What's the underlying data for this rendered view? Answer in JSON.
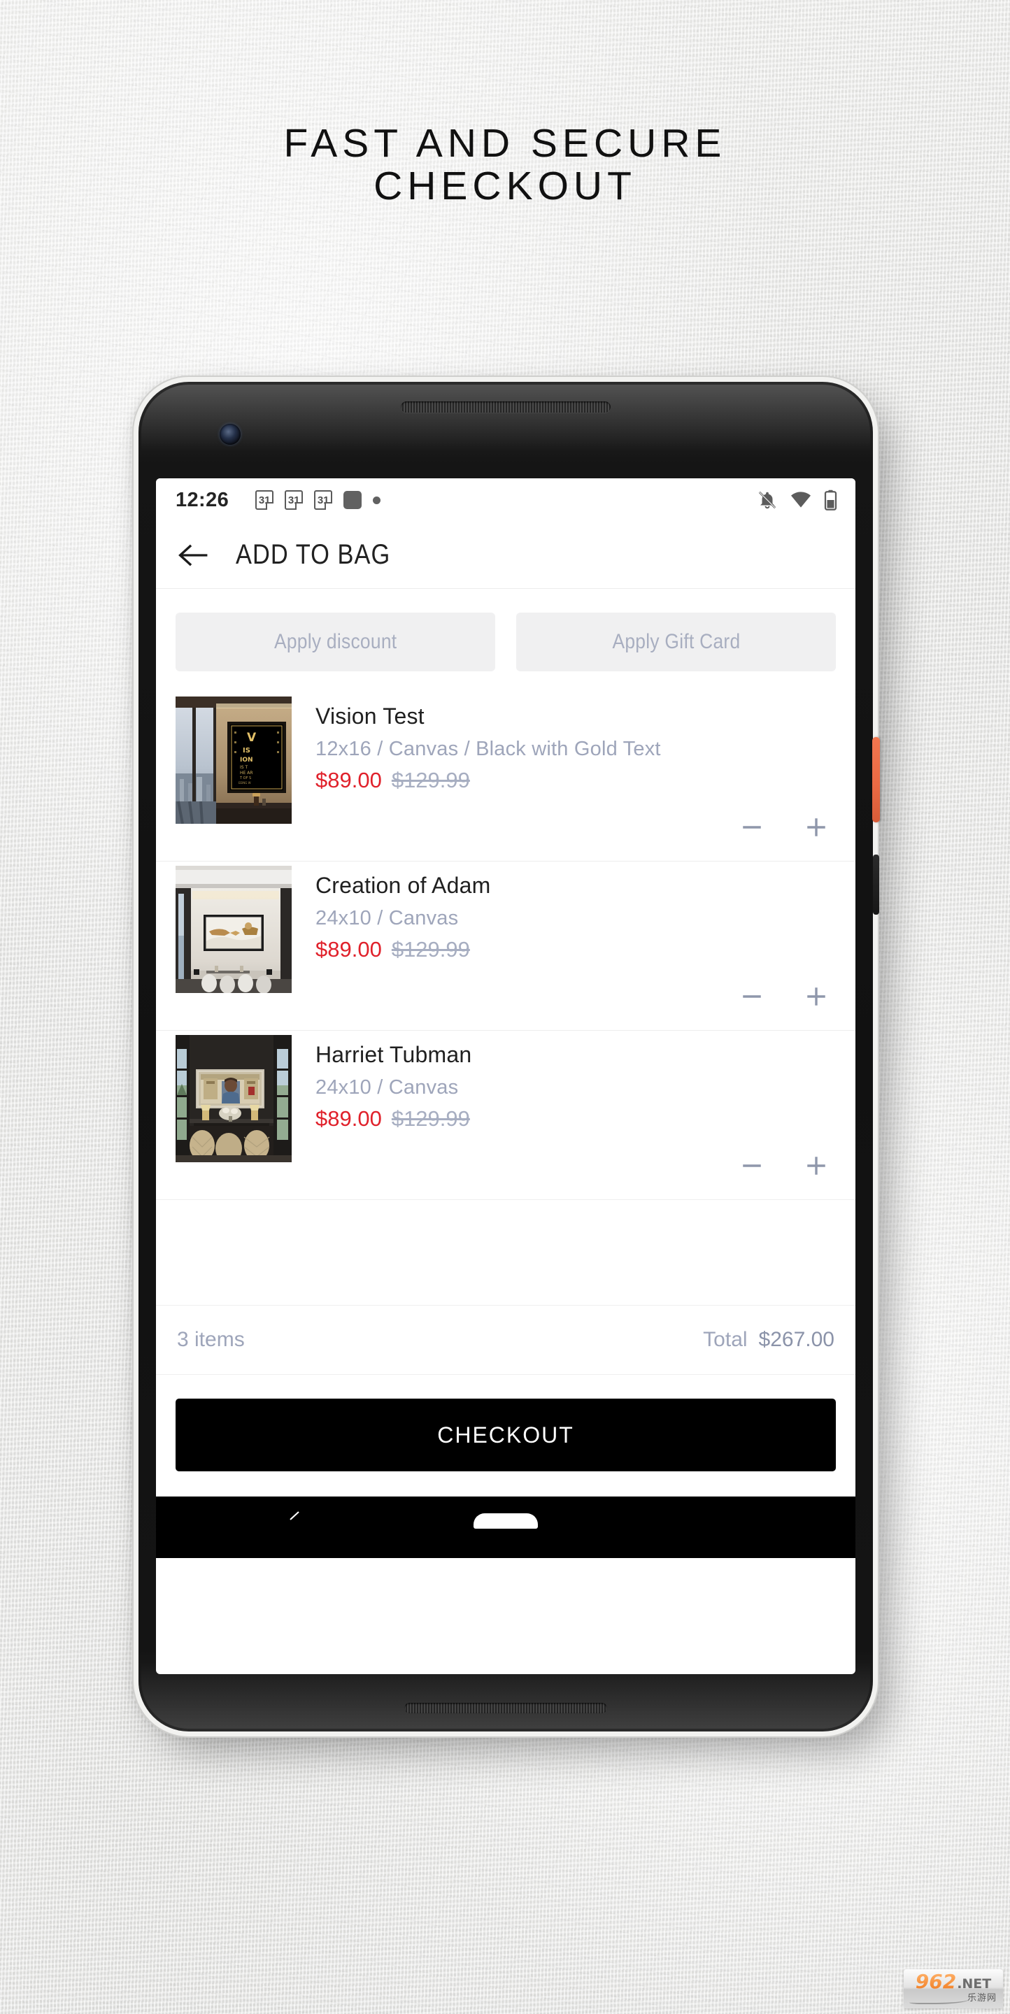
{
  "promo": {
    "headline_line1": "FAST AND SECURE",
    "headline_line2": "CHECKOUT"
  },
  "status_bar": {
    "time": "12:26",
    "calendar_badge": "31",
    "icons": [
      "calendar-icon",
      "calendar-icon",
      "calendar-icon",
      "square-icon",
      "dot-icon",
      "bell-off-icon",
      "wifi-icon",
      "battery-icon"
    ]
  },
  "appbar": {
    "back_label": "back-arrow",
    "title": "ADD TO BAG"
  },
  "promo_buttons": {
    "discount": "Apply discount",
    "gift_card": "Apply Gift Card"
  },
  "cart": {
    "items": [
      {
        "title": "Vision Test",
        "variant": "12x16 / Canvas / Black with Gold Text",
        "price_sale": "$89.00",
        "price_original": "$129.99",
        "thumb_name": "vision-test-artwork",
        "decrease_label": "−",
        "increase_label": "+"
      },
      {
        "title": "Creation of Adam",
        "variant": "24x10 / Canvas",
        "price_sale": "$89.00",
        "price_original": "$129.99",
        "thumb_name": "creation-of-adam-artwork",
        "decrease_label": "−",
        "increase_label": "+"
      },
      {
        "title": "Harriet Tubman",
        "variant": "24x10 / Canvas",
        "price_sale": "$89.00",
        "price_original": "$129.99",
        "thumb_name": "harriet-tubman-artwork",
        "decrease_label": "−",
        "increase_label": "+"
      }
    ]
  },
  "totals": {
    "item_count": "3 items",
    "total_label": "Total",
    "total_amount": "$267.00"
  },
  "checkout": {
    "label": "CHECKOUT"
  },
  "watermark": {
    "brand": "962",
    "domain": ".NET",
    "chinese": "乐游网"
  },
  "colors": {
    "sale_price": "#e0212b",
    "muted_text": "#9ea5ba",
    "power_button": "#ea6a44",
    "checkout_bg": "#000000",
    "promo_button_bg": "#f0f0f1"
  }
}
